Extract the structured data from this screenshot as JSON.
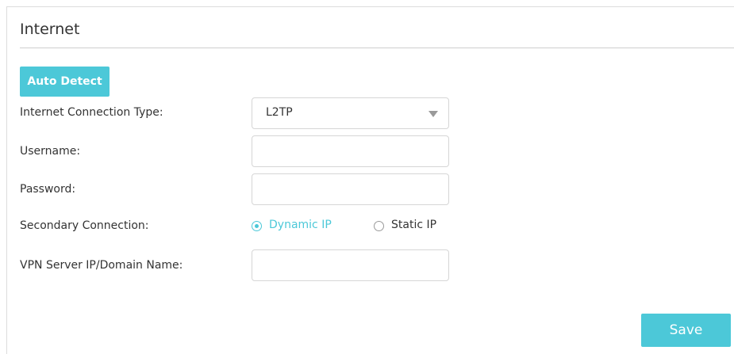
{
  "panel": {
    "title": "Internet"
  },
  "auto_detect": {
    "label": "Auto Detect"
  },
  "form": {
    "connection_type": {
      "label": "Internet Connection Type:",
      "value": "L2TP"
    },
    "username": {
      "label": "Username:",
      "value": "",
      "placeholder": ""
    },
    "password": {
      "label": "Password:",
      "value": "",
      "placeholder": ""
    },
    "secondary_connection": {
      "label": "Secondary Connection:",
      "options": [
        {
          "label": "Dynamic IP",
          "selected": true
        },
        {
          "label": "Static IP",
          "selected": false
        }
      ]
    },
    "vpn_server": {
      "label": "VPN Server IP/Domain Name:",
      "value": "",
      "placeholder": ""
    }
  },
  "save": {
    "label": "Save"
  },
  "colors": {
    "accent": "#4cc8d8",
    "text": "#333333",
    "border": "#d6d6d6",
    "divider": "#cfcfcf"
  },
  "icons": {
    "select_caret": "chevron-down-icon",
    "radio_selected": "radio-checked-icon",
    "radio_unselected": "radio-unchecked-icon"
  }
}
